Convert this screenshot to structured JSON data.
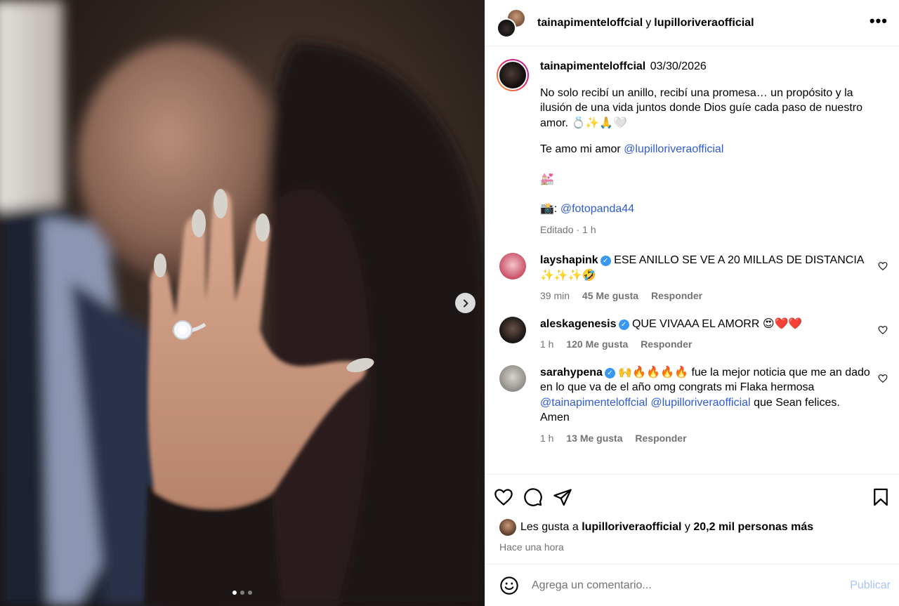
{
  "header": {
    "user1": "tainapimenteloffcial",
    "conj": "y",
    "user2": "lupilloriveraofficial",
    "more": "•••"
  },
  "media": {
    "slide_index": 1,
    "slide_count": 3
  },
  "caption": {
    "username": "tainapimenteloffcial",
    "date": "03/30/2026",
    "para1": "No solo recibí un anillo, recibí una promesa… un propósito y la ilusión de una vida juntos donde Dios guíe cada paso de nuestro amor. 💍✨🙏🤍",
    "para2_text": "Te amo mi amor",
    "para2_mention": "@lupilloriveraofficial",
    "para3": "💒",
    "para4_prefix": "📸:",
    "para4_mention": "@fotopanda44",
    "edited": "Editado",
    "sep": "·",
    "time": "1 h"
  },
  "comments": [
    {
      "username": "layshapink",
      "text": "ESE ANILLO SE VE A 20 MILLAS DE DISTANCIA ✨✨✨🤣",
      "time": "39 min",
      "likes": "45 Me gusta",
      "reply": "Responder"
    },
    {
      "username": "aleskagenesis",
      "text": "QUE VIVAAA EL AMORR 😍❤️❤️",
      "time": "1 h",
      "likes": "120 Me gusta",
      "reply": "Responder"
    },
    {
      "username": "sarahypena",
      "text_pre": "🙌🔥🔥🔥🔥 fue la mejor noticia que me an dado en lo que va de el año omg congrats mi Flaka hermosa",
      "mention1": "@tainapimenteloffcial",
      "mention2": "@lupilloriveraofficial",
      "text_post": "que Sean felices. Amen",
      "time": "1 h",
      "likes": "13 Me gusta",
      "reply": "Responder"
    }
  ],
  "likes": {
    "prefix": "Les gusta a",
    "user": "lupilloriveraofficial",
    "middle": "y",
    "count": "20,2 mil personas más",
    "ago": "Hace una hora"
  },
  "composer": {
    "placeholder": "Agrega un comentario...",
    "publish": "Publicar"
  },
  "colors": {
    "mention": "#2f5ad3",
    "verified": "#3897f0",
    "publish_disabled": "#a7c2f9"
  },
  "icons": [
    "heart-icon",
    "comment-icon",
    "share-icon",
    "bookmark-icon",
    "emoji-icon",
    "chevron-right-icon",
    "verified-icon",
    "more-icon"
  ]
}
